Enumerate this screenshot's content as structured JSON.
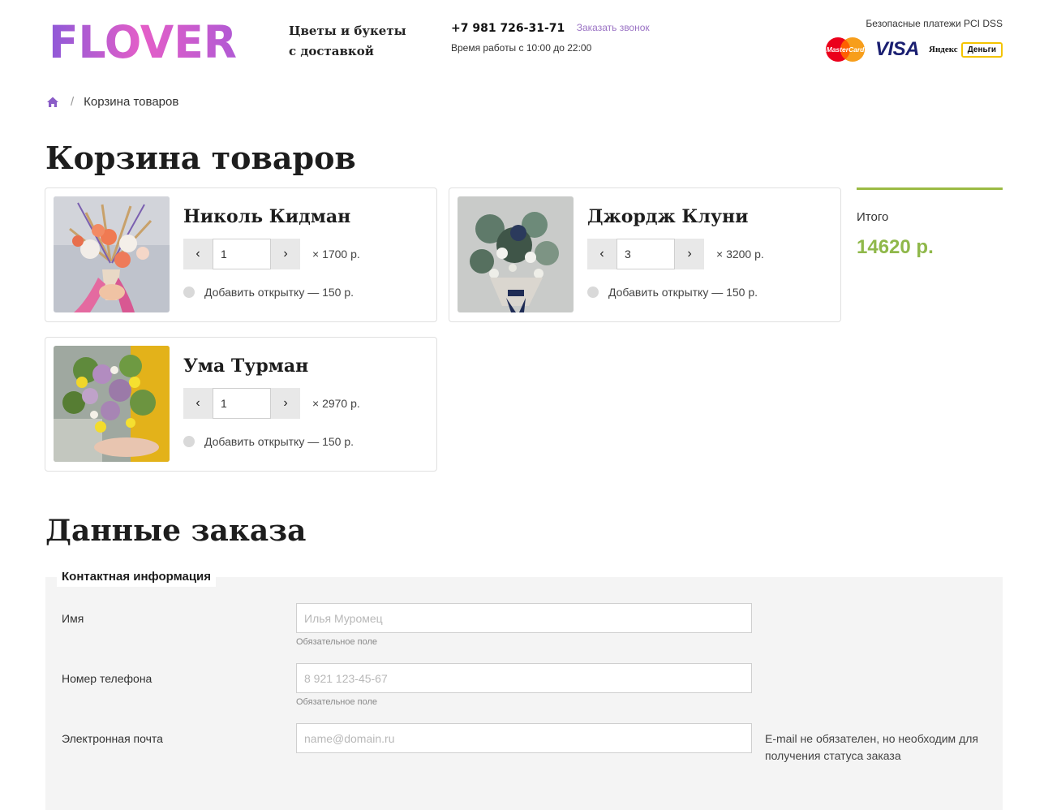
{
  "header": {
    "logo_text": "FLOVER",
    "tagline_line1": "Цветы и букеты",
    "tagline_line2": "с доставкой",
    "phone": "+7 981 726-31-71",
    "callback_link": "Заказать звонок",
    "hours": "Время работы с 10:00 до 22:00",
    "payments_title": "Безопасные платежи PCI DSS",
    "payment_logos": {
      "mastercard": "MasterCard",
      "visa": "VISA",
      "yandex": "Яндекс",
      "dengi": "Деньги"
    }
  },
  "breadcrumb": {
    "home_icon": "home-icon",
    "separator": "/",
    "current": "Корзина товаров"
  },
  "cart": {
    "title": "Корзина товаров",
    "items": [
      {
        "name": "Николь Кидман",
        "quantity": "1",
        "price": "× 1700 р.",
        "add_card": "Добавить открытку — 150 р."
      },
      {
        "name": "Джордж Клуни",
        "quantity": "3",
        "price": "× 3200 р.",
        "add_card": "Добавить открытку — 150 р."
      },
      {
        "name": "Ума Турман",
        "quantity": "1",
        "price": "× 2970 р.",
        "add_card": "Добавить открытку — 150 р."
      }
    ],
    "summary_label": "Итого",
    "summary_total": "14620 р."
  },
  "order": {
    "title": "Данные заказа",
    "section_title": "Контактная информация",
    "fields": [
      {
        "label": "Имя",
        "placeholder": "Илья Муромец",
        "hint": "Обязательное поле"
      },
      {
        "label": "Номер телефона",
        "placeholder": "8 921 123-45-67",
        "hint": "Обязательное поле"
      },
      {
        "label": "Электронная почта",
        "placeholder": "name@domain.ru",
        "note": "E-mail не обязателен, но необходим для получения статуса заказа"
      }
    ]
  },
  "colors": {
    "accent_purple": "#9a72c4",
    "total_green": "#8fb84a",
    "summary_border": "#9bbb44",
    "logo_gradient_start": "#8e5ad8",
    "logo_gradient_end": "#f062c8"
  }
}
